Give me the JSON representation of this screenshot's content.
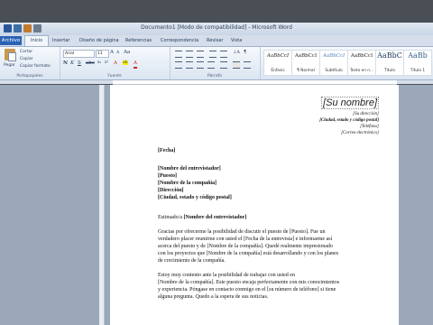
{
  "window": {
    "title": "Documento1 [Modo de compatibilidad] - Microsoft Word"
  },
  "file_tab": "Archivo",
  "tabs": [
    "Inicio",
    "Insertar",
    "Diseño de página",
    "Referencias",
    "Correspondencia",
    "Revisar",
    "Vista"
  ],
  "ribbon": {
    "clipboard": {
      "paste": "Pegar",
      "cut": "Cortar",
      "copy": "Copiar",
      "format_painter": "Copiar formato",
      "label": "Portapapeles"
    },
    "font": {
      "name": "Arial",
      "size": "11",
      "label": "Fuente"
    },
    "paragraph": {
      "label": "Párrafo"
    },
    "styles": {
      "items": [
        {
          "sample": "AaBbCcI",
          "name": "Énfasis"
        },
        {
          "sample": "AaBbCcI",
          "name": "¶ Normal"
        },
        {
          "sample": "AaBbCcI",
          "name": "Subtítulo"
        },
        {
          "sample": "AaBbCcI",
          "name": "Texto en n..."
        },
        {
          "sample": "AaBbC",
          "name": "Título"
        },
        {
          "sample": "AaBb",
          "name": "Título 1"
        }
      ]
    }
  },
  "document": {
    "header_name": "[Su nombre]",
    "header_address": "[Su dirección]",
    "header_city": "[Ciudad, estado y código postal]",
    "header_phone": "[Teléfono]",
    "header_email": "[Correo electrónico]",
    "date": "[Fecha]",
    "recipient_lines": [
      "[Nombre del entrevistador]",
      "[Puesto]",
      "[Nombre de la compañía]",
      "[Dirección]",
      "[Ciudad, estado y código postal]"
    ],
    "greeting_prefix": "Estimado/a ",
    "greeting_name": "[Nombre del entrevistador]",
    "p1": [
      "Gracias por ofrecerme la posibilidad de discutir el puesto de [Puesto]. Fue un",
      "verdadero placer reunirme con usted el [Fecha de la entrevista] e informarme así",
      "acerca del puesto y de [Nombre de la compañía]. Quedé realmente impresionado",
      "con los proyectos que [Nombre de la compañía] está desarrollando y con los planes",
      "de crecimiento de la compañía."
    ],
    "p2": [
      "Estoy muy contento ante la posibilidad de trabajar con usted en",
      "[Nombre de la compañía]. Este puesto encaja perfectamente con mis conocimientos",
      "y experiencia. Póngase en contacto conmigo en el [su número de teléfono] si tiene",
      "alguna pregunta. Quedo a la espera de sus noticias."
    ]
  }
}
